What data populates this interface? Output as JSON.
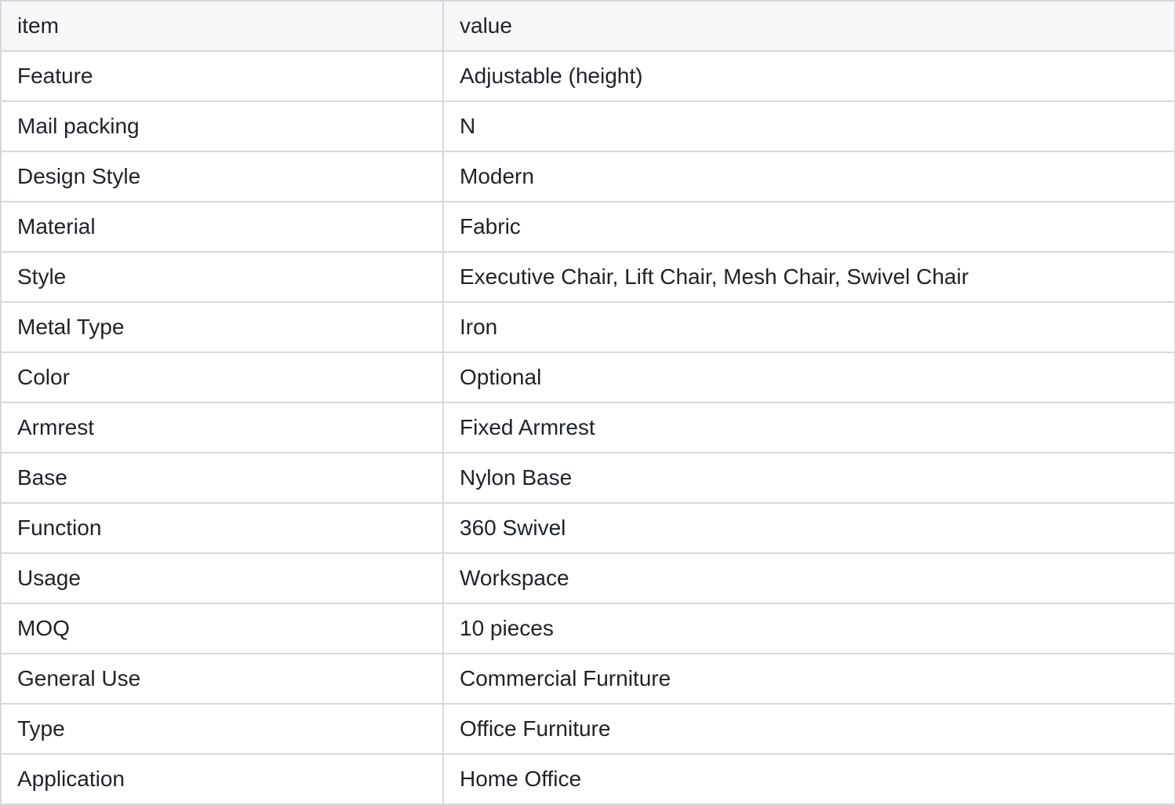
{
  "table": {
    "columns": [
      "item",
      "value"
    ],
    "rows": [
      {
        "item": "Feature",
        "value": "Adjustable (height)"
      },
      {
        "item": "Mail packing",
        "value": "N"
      },
      {
        "item": "Design Style",
        "value": "Modern"
      },
      {
        "item": "Material",
        "value": "Fabric"
      },
      {
        "item": "Style",
        "value": "Executive Chair, Lift Chair, Mesh Chair, Swivel Chair"
      },
      {
        "item": "Metal Type",
        "value": "Iron"
      },
      {
        "item": "Color",
        "value": "Optional"
      },
      {
        "item": "Armrest",
        "value": "Fixed Armrest"
      },
      {
        "item": "Base",
        "value": "Nylon Base"
      },
      {
        "item": "Function",
        "value": "360 Swivel"
      },
      {
        "item": "Usage",
        "value": "Workspace"
      },
      {
        "item": "MOQ",
        "value": "10 pieces"
      },
      {
        "item": "General Use",
        "value": "Commercial Furniture"
      },
      {
        "item": "Type",
        "value": "Office Furniture"
      },
      {
        "item": "Application",
        "value": "Home Office"
      }
    ]
  }
}
